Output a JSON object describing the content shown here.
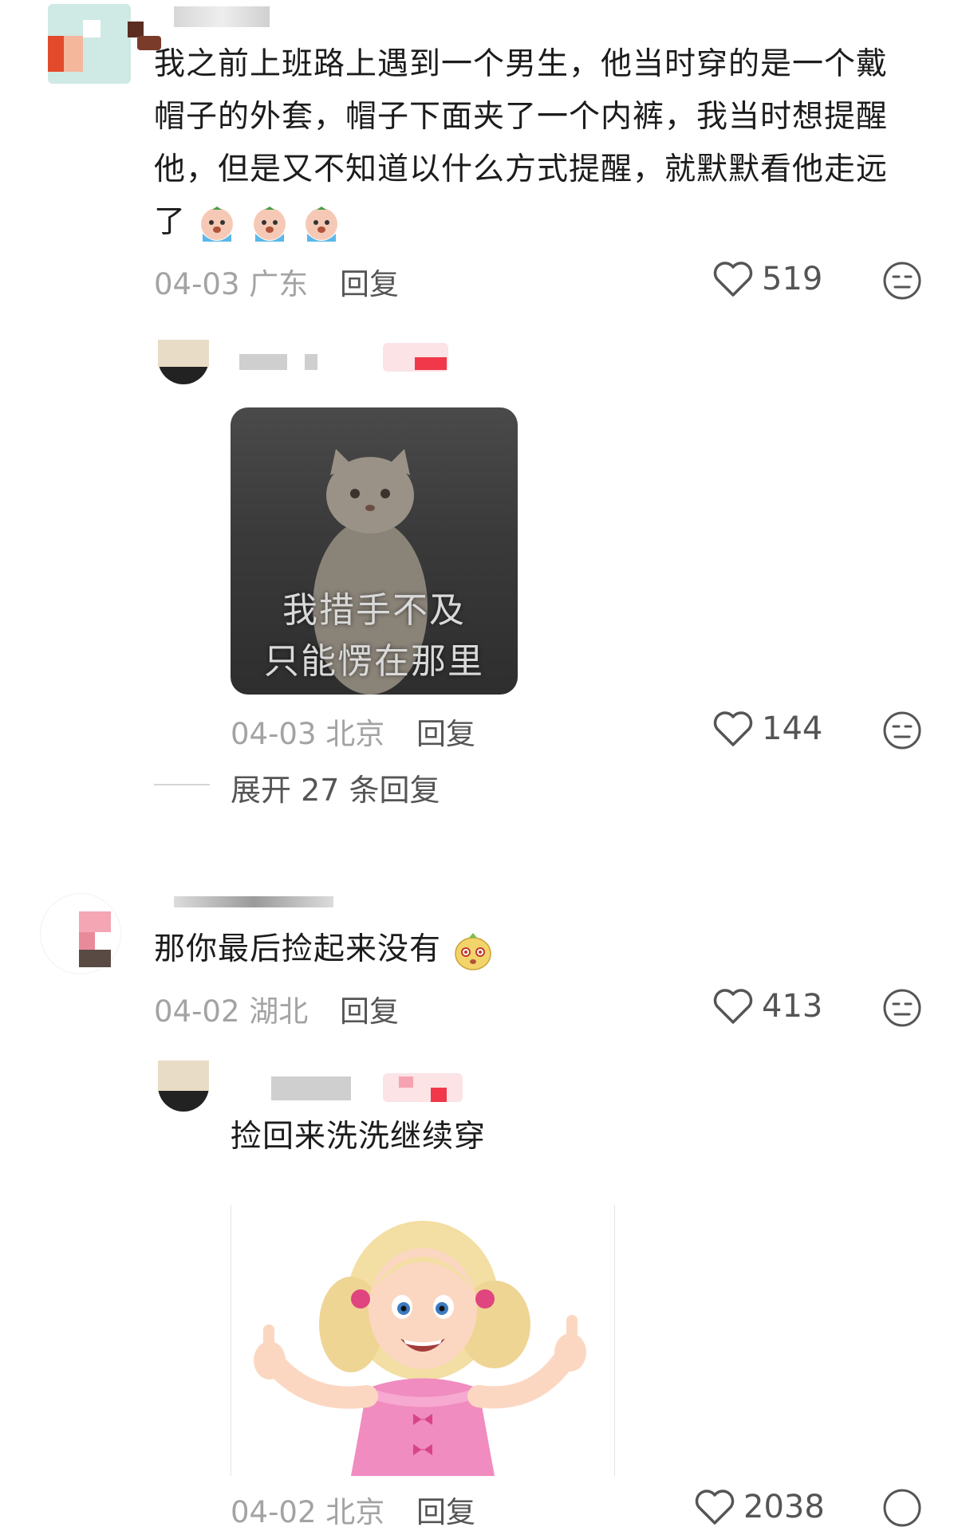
{
  "comments": [
    {
      "text_lines": [
        "我之前上班路上遇到一个男生，他当时穿的是一个戴",
        "帽子的外套，帽子下面夹了一个内裤，我当时想提醒",
        "他，但是又不知道以什么方式提醒，就默默看他走远",
        "了"
      ],
      "date": "04-03 广东",
      "reply_label": "回复",
      "likes": "519",
      "emoji_icons": [
        "crying-emoji-icon",
        "crying-emoji-icon",
        "crying-emoji-icon"
      ]
    },
    {
      "text": "那你最后捡起来没有",
      "date": "04-02 湖北",
      "reply_label": "回复",
      "likes": "413",
      "emoji_icons": [
        "shocked-emoji-icon"
      ]
    }
  ],
  "replies": [
    {
      "sticker_caption_line1": "我措手不及",
      "sticker_caption_line2": "只能愣在那里",
      "date": "04-03 北京",
      "reply_label": "回复",
      "likes": "144"
    },
    {
      "text": "捡回来洗洗继续穿",
      "date": "04-02 北京",
      "reply_label": "回复",
      "likes": "2038"
    }
  ],
  "expand_replies": "展开 27 条回复",
  "colors": {
    "text": "#1c1c1c",
    "meta": "#a3a3a3",
    "icon": "#555555",
    "badge_red": "#f0384a"
  }
}
